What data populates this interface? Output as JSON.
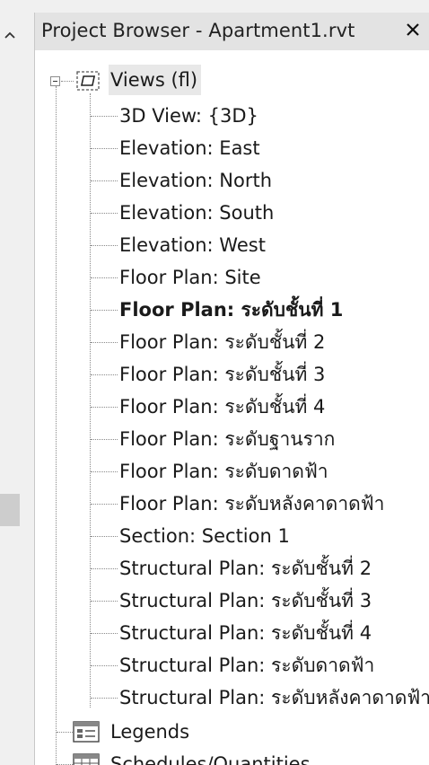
{
  "panel": {
    "title": "Project Browser - Apartment1.rvt",
    "close_glyph": "✕"
  },
  "tree": {
    "root": {
      "label": "Views (fl)",
      "icon": "views-icon",
      "expanded": true
    },
    "items": [
      {
        "label": "3D View: {3D}",
        "bold": false
      },
      {
        "label": "Elevation: East",
        "bold": false
      },
      {
        "label": "Elevation: North",
        "bold": false
      },
      {
        "label": "Elevation: South",
        "bold": false
      },
      {
        "label": "Elevation: West",
        "bold": false
      },
      {
        "label": "Floor Plan: Site",
        "bold": false
      },
      {
        "label": "Floor Plan: ระดับชั้นที่ 1",
        "bold": true
      },
      {
        "label": "Floor Plan: ระดับชั้นที่ 2",
        "bold": false
      },
      {
        "label": "Floor Plan: ระดับชั้นที่ 3",
        "bold": false
      },
      {
        "label": "Floor Plan: ระดับชั้นที่ 4",
        "bold": false
      },
      {
        "label": "Floor Plan: ระดับฐานราก",
        "bold": false
      },
      {
        "label": "Floor Plan: ระดับดาดฟ้า",
        "bold": false
      },
      {
        "label": "Floor Plan: ระดับหลังคาดาดฟ้า",
        "bold": false
      },
      {
        "label": "Section: Section 1",
        "bold": false
      },
      {
        "label": "Structural Plan: ระดับชั้นที่ 2",
        "bold": false
      },
      {
        "label": "Structural Plan: ระดับชั้นที่ 3",
        "bold": false
      },
      {
        "label": "Structural Plan: ระดับชั้นที่ 4",
        "bold": false
      },
      {
        "label": "Structural Plan: ระดับดาดฟ้า",
        "bold": false
      },
      {
        "label": "Structural Plan: ระดับหลังคาดาดฟ้า",
        "bold": false
      }
    ],
    "siblings": [
      {
        "label": "Legends",
        "icon": "legends-icon"
      },
      {
        "label": "Schedules/Quantities",
        "icon": "schedules-icon"
      }
    ]
  },
  "colors": {
    "titlebar_bg": "#e3e3e3",
    "panel_bg": "#ffffff",
    "root_highlight": "#e8e8e8",
    "text": "#1a1a1a"
  }
}
